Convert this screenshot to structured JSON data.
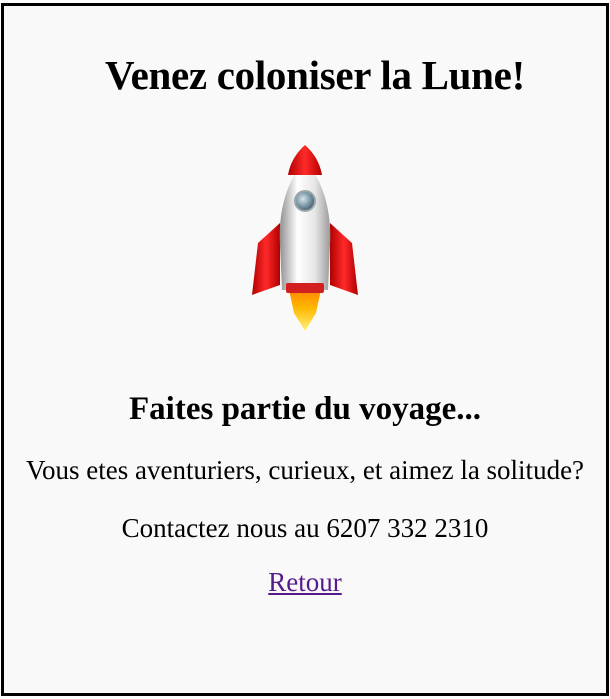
{
  "page": {
    "title": "Venez coloniser la Lune!",
    "image_icon": "rocket-emoji",
    "subtitle": "Faites partie du voyage...",
    "description": "Vous etes aventuriers, curieux, et aimez la solitude?",
    "contact": "Contactez nous au 6207 332 2310",
    "back_link_label": "Retour"
  },
  "colors": {
    "frame_border": "#000000",
    "background": "#f9f9f9",
    "text": "#000000",
    "visited_link": "#551a8b"
  }
}
